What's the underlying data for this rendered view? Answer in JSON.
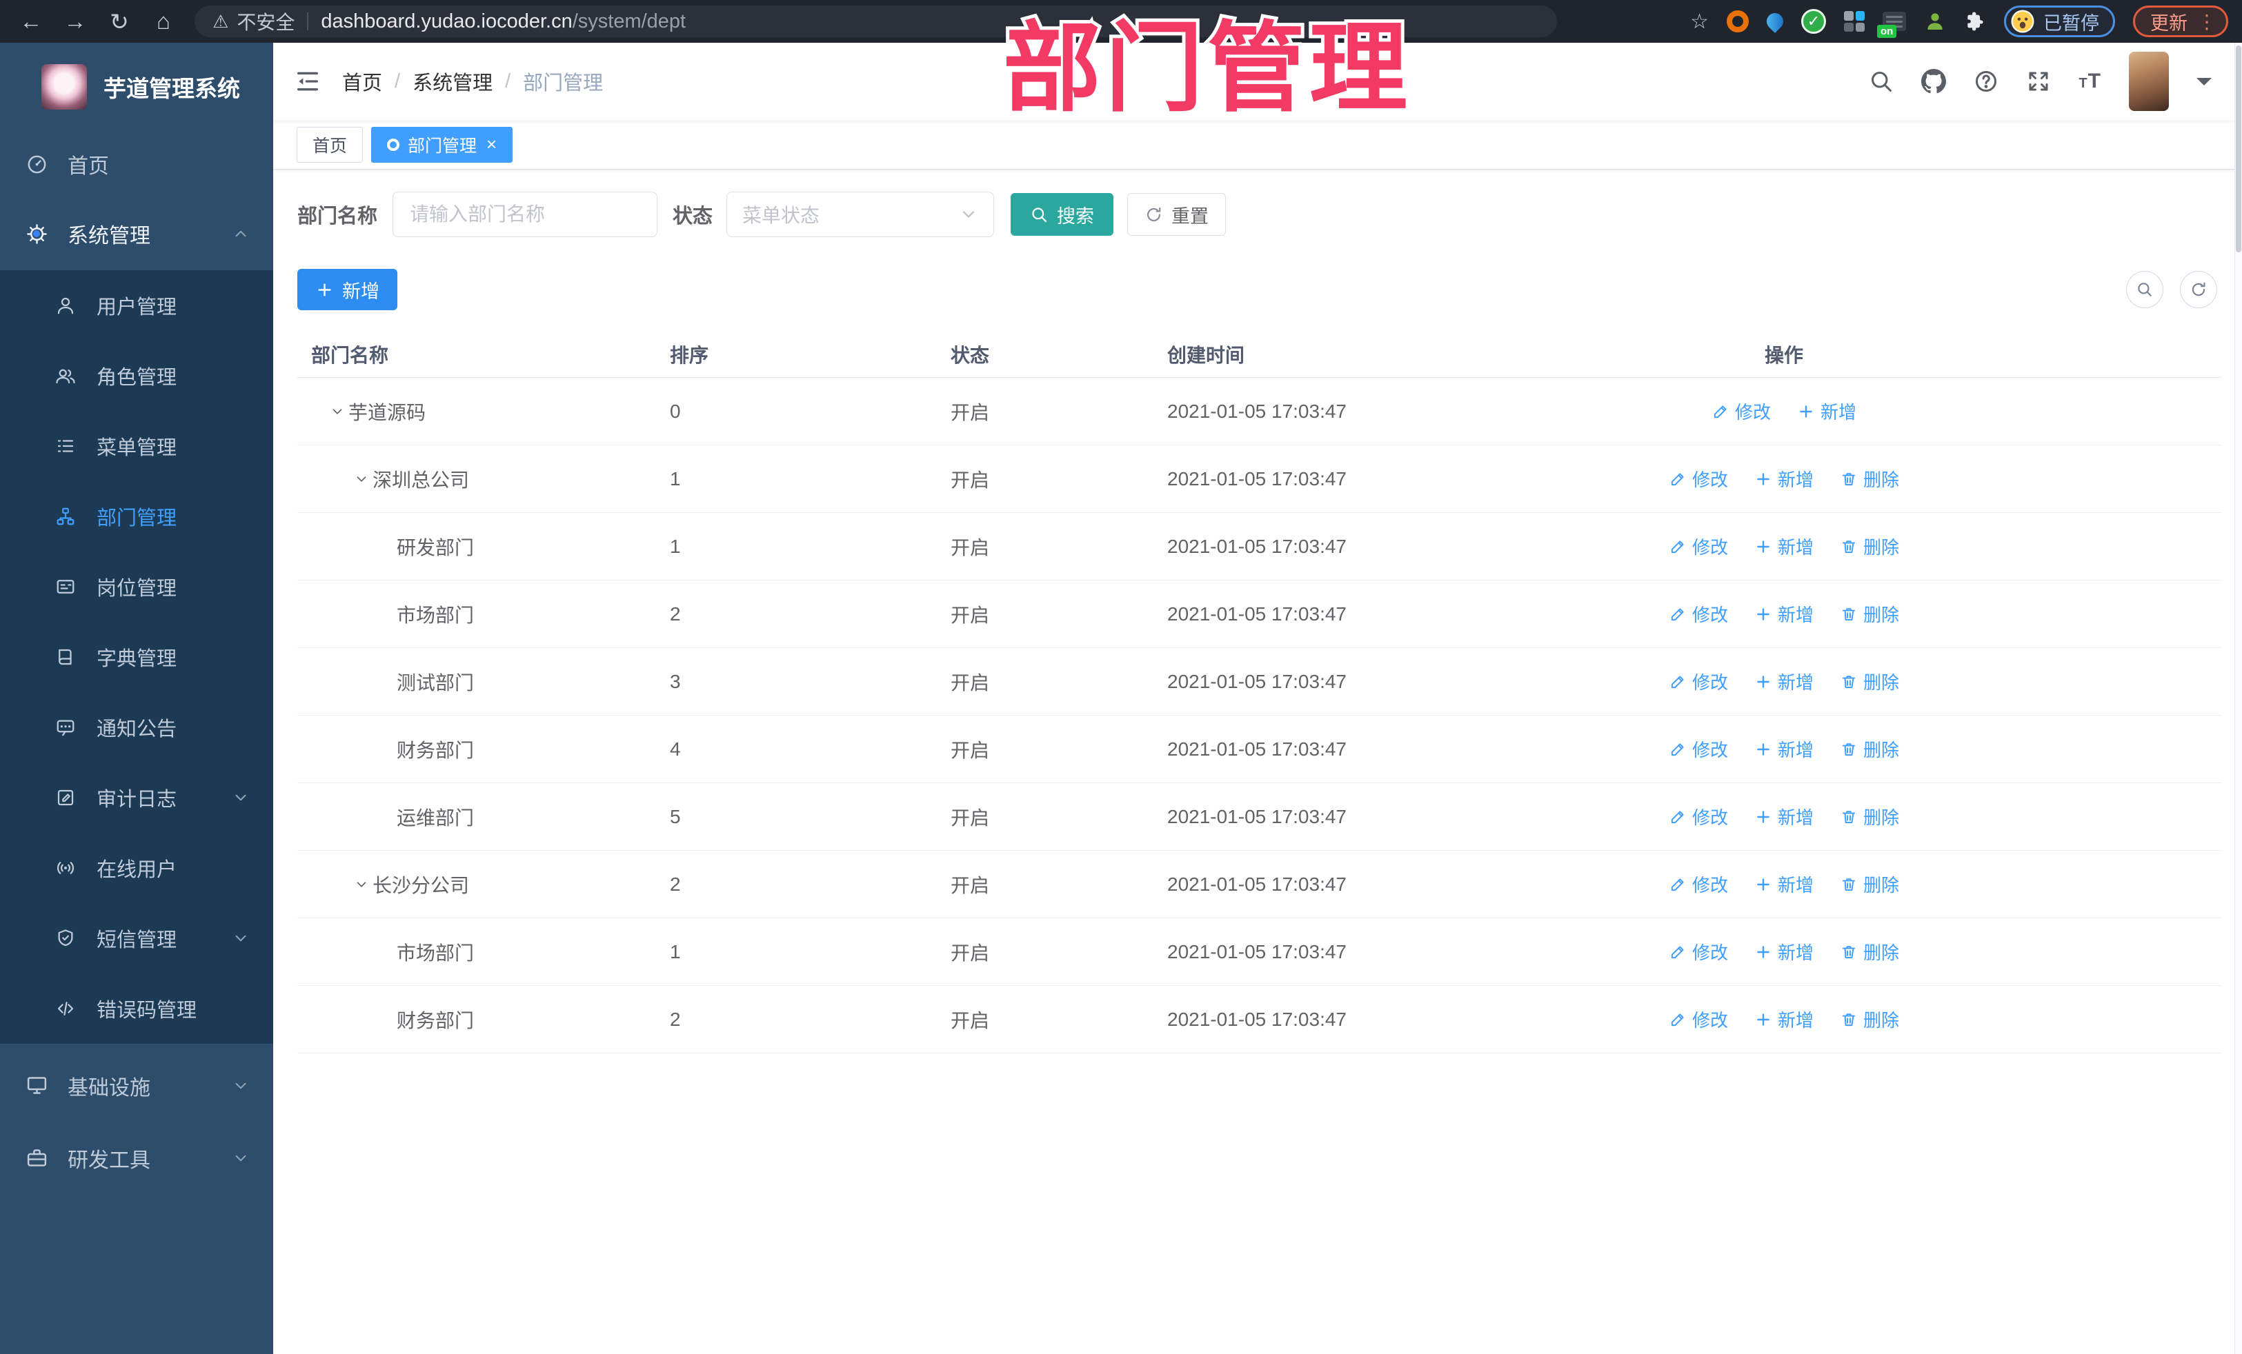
{
  "browser": {
    "security_label": "不安全",
    "url_host": "dashboard.yudao.iocoder.cn",
    "url_path": "/system/dept",
    "paused_badge_label": "已暂停",
    "update_button_label": "更新"
  },
  "watermark": "部门管理",
  "sidebar": {
    "app_title": "芋道管理系统",
    "top_items": [
      {
        "id": "home",
        "label": "首页",
        "icon": "dashboard"
      },
      {
        "id": "system",
        "label": "系统管理",
        "icon": "gear",
        "chevron": "up",
        "emphasis": true
      }
    ],
    "submenu_items": [
      {
        "id": "user",
        "label": "用户管理",
        "icon": "user"
      },
      {
        "id": "role",
        "label": "角色管理",
        "icon": "users"
      },
      {
        "id": "menu",
        "label": "菜单管理",
        "icon": "menu-list"
      },
      {
        "id": "dept",
        "label": "部门管理",
        "icon": "org-tree",
        "active": true
      },
      {
        "id": "post",
        "label": "岗位管理",
        "icon": "id-card"
      },
      {
        "id": "dict",
        "label": "字典管理",
        "icon": "book"
      },
      {
        "id": "notice",
        "label": "通知公告",
        "icon": "notice"
      },
      {
        "id": "audit-log",
        "label": "审计日志",
        "icon": "log",
        "chevron": "down"
      },
      {
        "id": "online-user",
        "label": "在线用户",
        "icon": "online"
      },
      {
        "id": "sms",
        "label": "短信管理",
        "icon": "sms",
        "chevron": "down"
      },
      {
        "id": "error-code",
        "label": "错误码管理",
        "icon": "code"
      }
    ],
    "bottom_items": [
      {
        "id": "infra",
        "label": "基础设施",
        "icon": "monitor",
        "chevron": "down"
      },
      {
        "id": "dev-tools",
        "label": "研发工具",
        "icon": "toolbox",
        "chevron": "down"
      }
    ]
  },
  "navbar": {
    "breadcrumb": [
      "首页",
      "系统管理",
      "部门管理"
    ]
  },
  "tabs": [
    {
      "label": "首页",
      "active": false,
      "closable": false
    },
    {
      "label": "部门管理",
      "active": true,
      "closable": true
    }
  ],
  "filters": {
    "name_label": "部门名称",
    "name_placeholder": "请输入部门名称",
    "status_label": "状态",
    "status_placeholder": "菜单状态",
    "search_label": "搜索",
    "reset_label": "重置"
  },
  "toolbar": {
    "add_label": "新增"
  },
  "table": {
    "columns": [
      "部门名称",
      "排序",
      "状态",
      "创建时间",
      "操作"
    ],
    "action_labels": {
      "edit": "修改",
      "add": "新增",
      "delete": "删除"
    },
    "rows": [
      {
        "name": "芋道源码",
        "level": 0,
        "expandable": true,
        "sort": "0",
        "status": "开启",
        "created": "2021-01-05 17:03:47",
        "actions": [
          "edit",
          "add"
        ]
      },
      {
        "name": "深圳总公司",
        "level": 1,
        "expandable": true,
        "sort": "1",
        "status": "开启",
        "created": "2021-01-05 17:03:47",
        "actions": [
          "edit",
          "add",
          "delete"
        ]
      },
      {
        "name": "研发部门",
        "level": 2,
        "expandable": false,
        "sort": "1",
        "status": "开启",
        "created": "2021-01-05 17:03:47",
        "actions": [
          "edit",
          "add",
          "delete"
        ]
      },
      {
        "name": "市场部门",
        "level": 2,
        "expandable": false,
        "sort": "2",
        "status": "开启",
        "created": "2021-01-05 17:03:47",
        "actions": [
          "edit",
          "add",
          "delete"
        ]
      },
      {
        "name": "测试部门",
        "level": 2,
        "expandable": false,
        "sort": "3",
        "status": "开启",
        "created": "2021-01-05 17:03:47",
        "actions": [
          "edit",
          "add",
          "delete"
        ]
      },
      {
        "name": "财务部门",
        "level": 2,
        "expandable": false,
        "sort": "4",
        "status": "开启",
        "created": "2021-01-05 17:03:47",
        "actions": [
          "edit",
          "add",
          "delete"
        ]
      },
      {
        "name": "运维部门",
        "level": 2,
        "expandable": false,
        "sort": "5",
        "status": "开启",
        "created": "2021-01-05 17:03:47",
        "actions": [
          "edit",
          "add",
          "delete"
        ]
      },
      {
        "name": "长沙分公司",
        "level": 1,
        "expandable": true,
        "sort": "2",
        "status": "开启",
        "created": "2021-01-05 17:03:47",
        "actions": [
          "edit",
          "add",
          "delete"
        ]
      },
      {
        "name": "市场部门",
        "level": 2,
        "expandable": false,
        "sort": "1",
        "status": "开启",
        "created": "2021-01-05 17:03:47",
        "actions": [
          "edit",
          "add",
          "delete"
        ]
      },
      {
        "name": "财务部门",
        "level": 2,
        "expandable": false,
        "sort": "2",
        "status": "开启",
        "created": "2021-01-05 17:03:47",
        "actions": [
          "edit",
          "add",
          "delete"
        ]
      }
    ]
  },
  "colors": {
    "accent_blue": "#409eff",
    "primary_button_blue": "#2d8cf0",
    "search_teal": "#2aa79e",
    "watermark_pink": "#f23a64",
    "sidebar_bg": "#2e4d6b",
    "submenu_bg": "#1d3a55",
    "chrome_bg": "#20242c"
  }
}
